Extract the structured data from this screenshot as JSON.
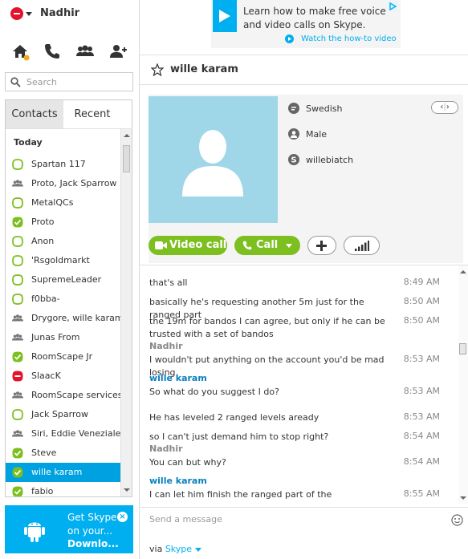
{
  "user": {
    "name": "Nadhir"
  },
  "search": {
    "placeholder": "Search"
  },
  "tabs": {
    "contacts": "Contacts",
    "recent": "Recent"
  },
  "list": {
    "section": "Today",
    "contacts": [
      {
        "name": "Spartan 117",
        "status": "away"
      },
      {
        "name": "Proto, Jack Sparrow",
        "status": "group"
      },
      {
        "name": "MetalQCs",
        "status": "away"
      },
      {
        "name": "Proto",
        "status": "online"
      },
      {
        "name": "Anon",
        "status": "away"
      },
      {
        "name": "'Rsgoldmarkt",
        "status": "away"
      },
      {
        "name": "SupremeLeader",
        "status": "away"
      },
      {
        "name": "f0bba-",
        "status": "away"
      },
      {
        "name": "Drygore, wille karam",
        "status": "group"
      },
      {
        "name": "Junas From",
        "status": "group"
      },
      {
        "name": "RoomScape Jr",
        "status": "online"
      },
      {
        "name": "SlaacK",
        "status": "busy"
      },
      {
        "name": "RoomScape services",
        "status": "group"
      },
      {
        "name": "Jack Sparrow",
        "status": "away"
      },
      {
        "name": "Siri, Eddie Veneziale",
        "status": "group"
      },
      {
        "name": "Steve",
        "status": "online"
      },
      {
        "name": "wille karam",
        "status": "online",
        "selected": true
      },
      {
        "name": "fabio",
        "status": "online"
      }
    ]
  },
  "promo": {
    "line1": "Get Skype",
    "line2": "on your...",
    "line3": "Downlo..."
  },
  "ad": {
    "line1": "Learn how to make free voice",
    "line2": "and video calls on Skype.",
    "link": "Watch the how-to video"
  },
  "conversation": {
    "name": "wille karam",
    "profile": {
      "language": "Swedish",
      "gender": "Male",
      "skype_name": "willebiatch"
    },
    "buttons": {
      "video": "Video call",
      "call": "Call"
    }
  },
  "messages": [
    {
      "text": "that's all",
      "time": "8:49 AM"
    },
    {
      "text": "basically he's requesting another 5m just for the ranged part",
      "time": "8:50 AM"
    },
    {
      "text": "the 19m for bandos I can agree, but only if he can be trusted with a set of bandos",
      "time": "8:50 AM"
    },
    {
      "sender": "Nadhir",
      "text": "I wouldn't put anything on the account you'd be mad losing.",
      "time": "8:53 AM"
    },
    {
      "sender": "wille karam",
      "text": "So what do you suggest I do?",
      "time": "8:53 AM"
    },
    {
      "text": "He has leveled 2 ranged levels aready",
      "time": "8:53 AM"
    },
    {
      "text": "so I can't just demand him to stop right?",
      "time": "8:54 AM"
    },
    {
      "sender": "Nadhir",
      "text": "You can but why?",
      "time": "8:54 AM"
    },
    {
      "sender": "wille karam",
      "text": "I can let him finish the ranged part of the powerleveling, but",
      "time": "8:55 AM"
    }
  ],
  "compose": {
    "placeholder": "Send a message"
  },
  "footer": {
    "via": "via",
    "service": "Skype"
  },
  "colors": {
    "accent": "#00aff0",
    "green": "#7cbf1f",
    "busy": "#e3132c",
    "selected": "#00a1e0"
  }
}
